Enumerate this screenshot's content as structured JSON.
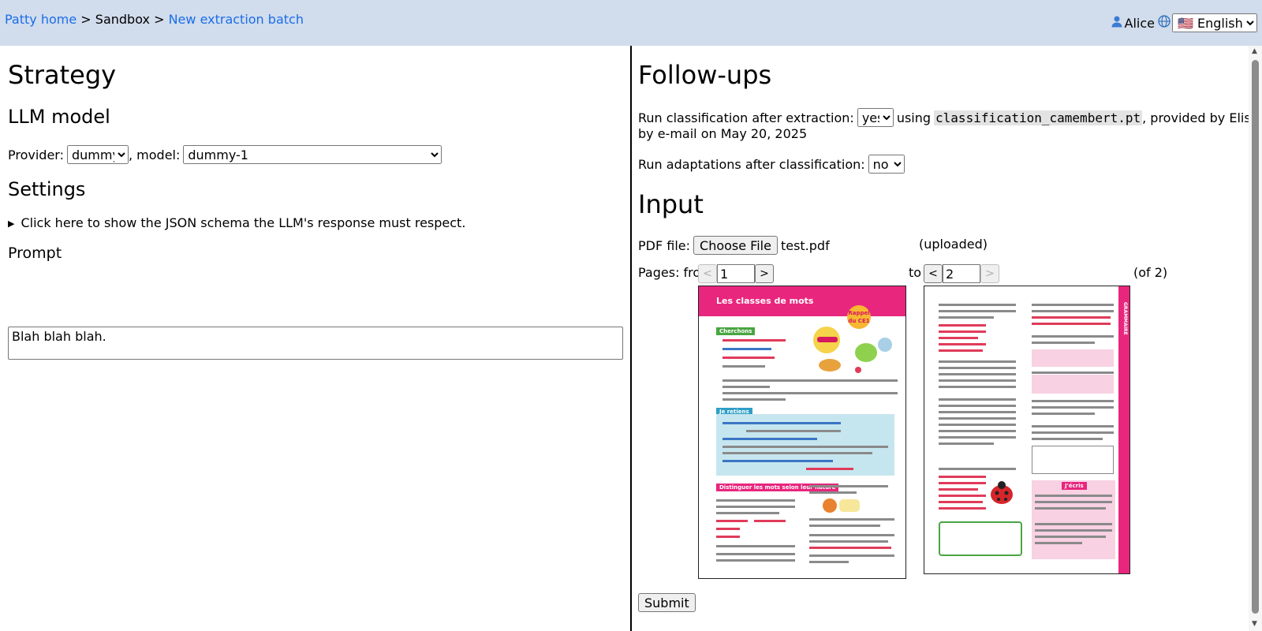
{
  "breadcrumb": {
    "home": "Patty home",
    "sep1": ">",
    "sandbox": "Sandbox",
    "sep2": ">",
    "current": "New extraction batch"
  },
  "user": {
    "icon": "person-icon",
    "name": "Alice",
    "globe_icon": "globe-icon",
    "language": "🇺🇸 English"
  },
  "left": {
    "strategy_title": "Strategy",
    "llm_title": "LLM model",
    "provider_label": "Provider:",
    "provider_value": "dummy",
    "model_label": ", model:",
    "model_value": "dummy-1",
    "settings_title": "Settings",
    "schema_toggle": "Click here to show the JSON schema the LLM's response must respect.",
    "prompt_title": "Prompt",
    "prompt_value": "Blah blah blah."
  },
  "right": {
    "followups_title": "Follow-ups",
    "classif_label": "Run classification after extraction:",
    "classif_value": "yes",
    "using_text": "using",
    "model_file": "classification_camembert.pt",
    "provided_by": ", provided by Elise",
    "provided_line2": "by e-mail on May 20, 2025",
    "adapt_label": "Run adaptations after classification:",
    "adapt_value": "no",
    "input_title": "Input",
    "pdf_label": "PDF file:",
    "choose_file": "Choose File",
    "file_name": "test.pdf",
    "uploaded": "(uploaded)",
    "pages_from": "Pages: from",
    "from_value": "1",
    "to_label": "to",
    "to_value": "2",
    "of_total": "(of 2)",
    "prev": "<",
    "next": ">",
    "submit": "Submit"
  },
  "thumbnails": {
    "page1_title": "Les classes de mots",
    "page1_badge": "Rappel du CE1",
    "page1_tag_cherchons": "Cherchons",
    "page1_tag_jeretiens": "Je retiens",
    "page1_tag_distinguer": "Distinguer les mots selon leur nature",
    "page2_side": "GRAMMAIRE",
    "page2_tag": "J'écris"
  },
  "colors": {
    "topbar": "#d1dcec",
    "link": "#1a6ee8",
    "accent_pink": "#e8267d"
  }
}
